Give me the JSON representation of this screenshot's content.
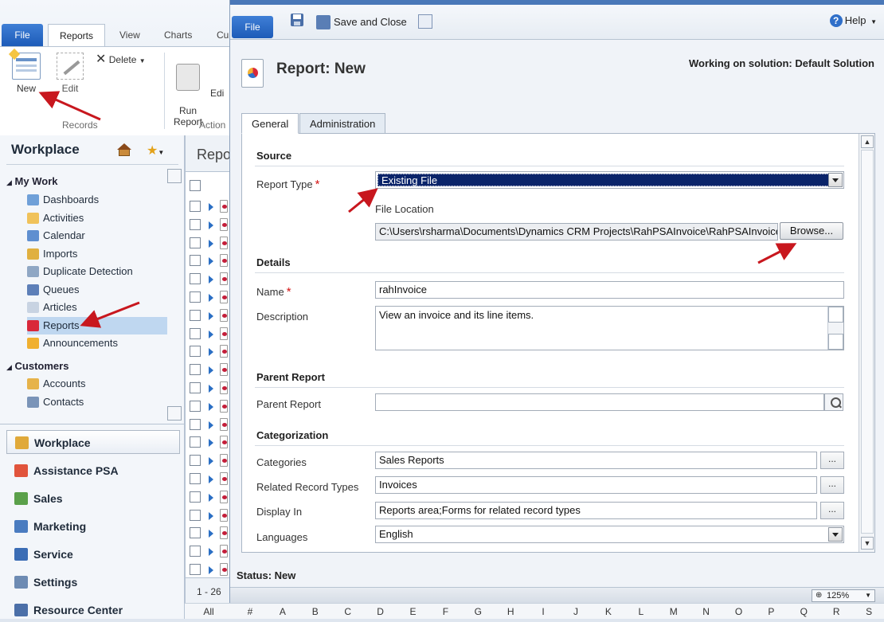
{
  "background": {
    "ribbon": {
      "file_tab": "File",
      "tabs": [
        "Reports",
        "View",
        "Charts",
        "Cu"
      ],
      "buttons": {
        "new": "New",
        "edit": "Edit",
        "delete": "Delete",
        "run_report": "Run\nReport",
        "edit2": "Edi"
      },
      "groups": {
        "records": "Records",
        "actions": "Action"
      }
    },
    "nav": {
      "title": "Workplace",
      "my_work": "My Work",
      "my_work_items": [
        "Dashboards",
        "Activities",
        "Calendar",
        "Imports",
        "Duplicate Detection",
        "Queues",
        "Articles",
        "Reports",
        "Announcements"
      ],
      "selected_item": "Reports",
      "customers": "Customers",
      "customer_items": [
        "Accounts",
        "Contacts"
      ],
      "workspaces": [
        "Workplace",
        "Assistance PSA",
        "Sales",
        "Marketing",
        "Service",
        "Settings",
        "Resource Center"
      ]
    },
    "grid": {
      "header": "Repo",
      "paging": "1 - 26"
    },
    "alphabet": [
      "All",
      "#",
      "A",
      "B",
      "C",
      "D",
      "E",
      "F",
      "G",
      "H",
      "I",
      "J",
      "K",
      "L",
      "M",
      "N",
      "O",
      "P",
      "Q",
      "R",
      "S"
    ]
  },
  "dialog": {
    "toolbar": {
      "file": "File",
      "save_close": "Save and Close",
      "help": "Help"
    },
    "title": "Report: New",
    "solution": "Working on solution: Default Solution",
    "tabs": [
      "General",
      "Administration"
    ],
    "sections": {
      "source": "Source",
      "details": "Details",
      "parent": "Parent Report",
      "categorization": "Categorization"
    },
    "fields": {
      "report_type_label": "Report Type",
      "report_type_value": "Existing File",
      "file_location_label": "File Location",
      "file_location_value": "C:\\Users\\rsharma\\Documents\\Dynamics CRM Projects\\RahPSAInvoice\\RahPSAInvoice\\c",
      "browse": "Browse...",
      "name_label": "Name",
      "name_value": "rahInvoice",
      "description_label": "Description",
      "description_value": "View an invoice and its line items.",
      "parent_label": "Parent Report",
      "parent_value": "",
      "categories_label": "Categories",
      "categories_value": "Sales Reports",
      "related_label": "Related Record Types",
      "related_value": "Invoices",
      "display_label": "Display In",
      "display_value": "Reports area;Forms for related record types",
      "languages_label": "Languages",
      "languages_value": "English",
      "dots": "..."
    },
    "status_label": "Status: New",
    "zoom": "125%"
  }
}
